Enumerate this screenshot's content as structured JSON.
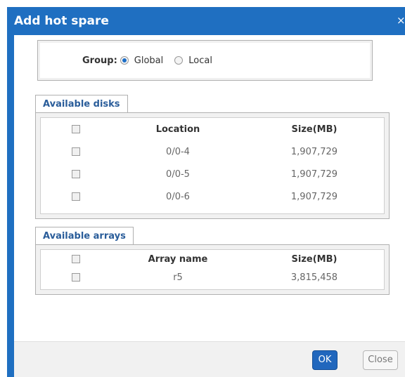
{
  "dialog": {
    "title": "Add hot spare",
    "close_glyph": "×"
  },
  "group": {
    "label": "Group:",
    "options": [
      {
        "label": "Global",
        "selected": true
      },
      {
        "label": "Local",
        "selected": false
      }
    ]
  },
  "disks": {
    "tab_label": "Available disks",
    "headers": {
      "location": "Location",
      "size": "Size(MB)"
    },
    "rows": [
      {
        "location": "0/0-4",
        "size": "1,907,729"
      },
      {
        "location": "0/0-5",
        "size": "1,907,729"
      },
      {
        "location": "0/0-6",
        "size": "1,907,729"
      }
    ]
  },
  "arrays": {
    "tab_label": "Available arrays",
    "headers": {
      "name": "Array name",
      "size": "Size(MB)"
    },
    "rows": [
      {
        "name": "r5",
        "size": "3,815,458"
      }
    ]
  },
  "footer": {
    "ok_label": "OK",
    "close_label": "Close"
  },
  "colors": {
    "title_bar": "#1f6fc1",
    "ok_button": "#2167bd",
    "tab_text": "#2a5d9a"
  }
}
